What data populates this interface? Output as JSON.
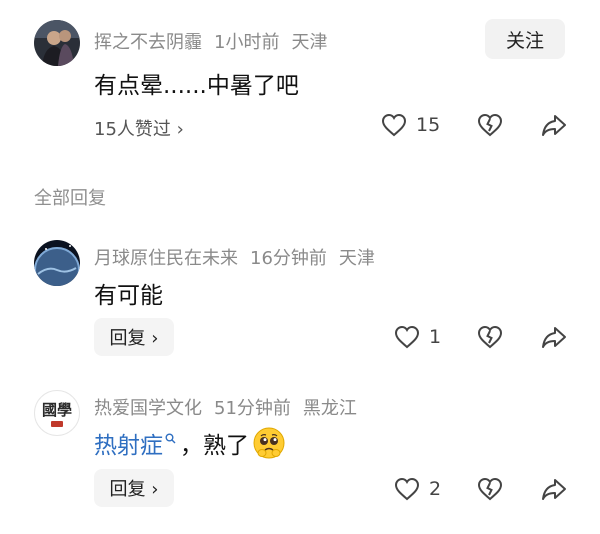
{
  "main_comment": {
    "username": "挥之不去阴霾",
    "time": "1小时前",
    "location": "天津",
    "follow_label": "关注",
    "text": "有点晕......中暑了吧",
    "likes_link": "15人赞过 ›",
    "like_count": "15"
  },
  "section_title": "全部回复",
  "replies": [
    {
      "username": "月球原住民在未来",
      "time": "16分钟前",
      "location": "天津",
      "text": "有可能",
      "reply_label": "回复 ›",
      "like_count": "1"
    },
    {
      "username": "热爱国学文化",
      "time": "51分钟前",
      "location": "黑龙江",
      "text_link": "热射症",
      "text_rest": "，熟了",
      "avatar_text": "國學",
      "reply_label": "回复 ›",
      "like_count": "2"
    }
  ],
  "icons": [
    "like-icon",
    "dislike-icon",
    "share-icon",
    "search-icon",
    "pleading-emoji-icon"
  ],
  "colors": {
    "link": "#2f6fc1",
    "meta": "#8a8a8a",
    "button_bg": "#f2f2f2"
  }
}
